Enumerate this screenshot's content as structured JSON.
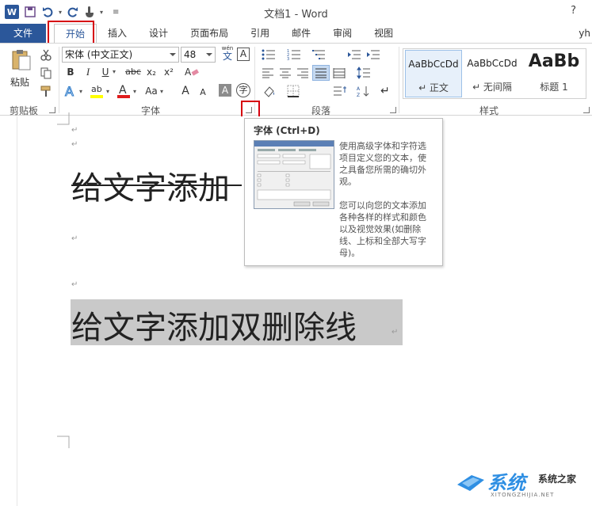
{
  "window": {
    "title": "文档1 - Word",
    "help": "?",
    "user": "yh"
  },
  "quick_access": {
    "logo_letter": "W",
    "icons": [
      "save-icon",
      "undo-icon",
      "redo-icon",
      "touch-mode-icon",
      "customize-icon"
    ]
  },
  "tabs": [
    {
      "label": "文件"
    },
    {
      "label": "开始"
    },
    {
      "label": "插入"
    },
    {
      "label": "设计"
    },
    {
      "label": "页面布局"
    },
    {
      "label": "引用"
    },
    {
      "label": "邮件"
    },
    {
      "label": "审阅"
    },
    {
      "label": "视图"
    }
  ],
  "clipboard": {
    "paste_label": "粘贴",
    "group_label": "剪贴板"
  },
  "font": {
    "group_label": "字体",
    "font_name": "宋体 (中文正文)",
    "font_size": "48",
    "wen_label": "wén",
    "wen_char": "文",
    "a_label": "A",
    "bold": "B",
    "italic": "I",
    "underline": "U",
    "strikethrough": "abc",
    "subscript": "x₂",
    "superscript": "x²",
    "case_label": "Aa",
    "grow": "A",
    "shrink": "A",
    "circled": "字"
  },
  "paragraph": {
    "group_label": "段落"
  },
  "styles": {
    "group_label": "样式",
    "items": [
      {
        "sample": "AaBbCcDd",
        "name": "↵ 正文"
      },
      {
        "sample": "AaBbCcDd",
        "name": "↵ 无间隔"
      },
      {
        "sample": "AaBb",
        "name": "标题 1"
      }
    ]
  },
  "document": {
    "line1": "给文字添加",
    "line2": "给文字添加双删除线",
    "para_mark": "↵"
  },
  "tooltip": {
    "title": "字体 (Ctrl+D)",
    "text1_lines": [
      "使用高级字体和字符选",
      "项目定义您的文本，使",
      "之具备您所需的确切外",
      "观。"
    ],
    "text2_lines": [
      "您可以向您的文本添加",
      "各种各样的样式和颜色",
      "以及视觉效果(如删除",
      "线、上标和全部大写字",
      "母)。"
    ]
  },
  "watermark": {
    "brand": "系统",
    "cn": "系统之家",
    "site": "XITONGZHIJIA.NET"
  },
  "colors": {
    "word_blue": "#2b579a",
    "highlight": "#c9c9c9",
    "red_box": "#d6000f"
  }
}
